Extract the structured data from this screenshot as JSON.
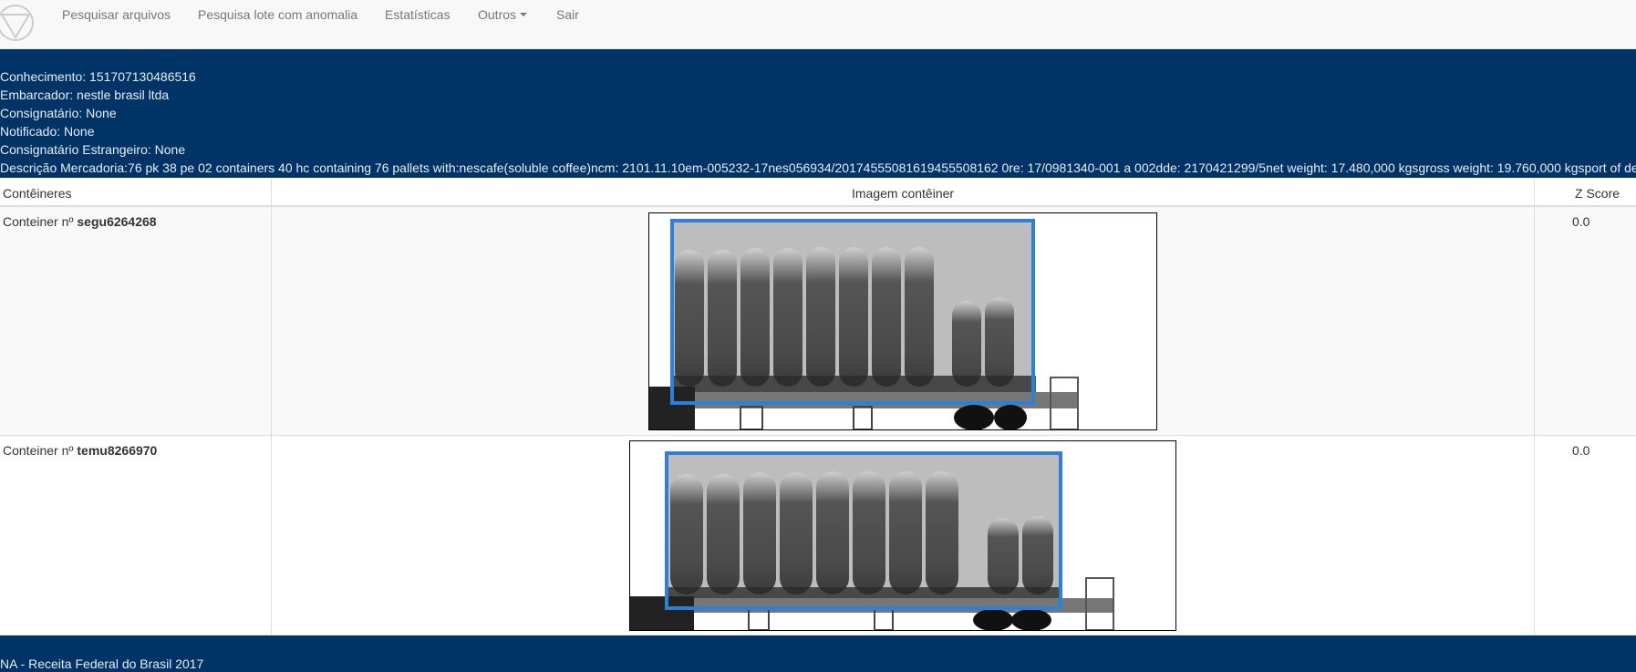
{
  "nav": {
    "logo_icon": "triangle-circle-logo-icon",
    "items": [
      {
        "label": "Pesquisar arquivos"
      },
      {
        "label": "Pesquisa lote com anomalia"
      },
      {
        "label": "Estatísticas"
      },
      {
        "label": "Outros",
        "dropdown": true
      },
      {
        "label": "Sair"
      }
    ]
  },
  "info": {
    "conhecimento": "Conhecimento: 151707130486516",
    "embarcador": "Embarcador: nestle brasil ltda",
    "consignatario": "Consignatário: None",
    "notificado": "Notificado: None",
    "consignatario_estrangeiro": "Consignatário Estrangeiro: None",
    "descricao": "Descrição Mercadoria:76 pk 38 pe 02 containers 40 hc containing 76 pallets with:nescafe(soluble coffee)ncm: 2101.11.10em-005232-17nes056934/20174555081619455508162 0re: 17/0981340-001 a 002dde: 2170421299/5net weight: 17.480,000 kgsgross weight: 19.760,000 kgsport of destination"
  },
  "table": {
    "headers": [
      "Contêineres",
      "Imagem contêiner",
      "Z Score"
    ],
    "rows": [
      {
        "prefix": "Conteiner nº ",
        "id": "segu6264268",
        "zscore": "0.0"
      },
      {
        "prefix": "Conteiner nº ",
        "id": "temu8266970",
        "zscore": "0.0"
      }
    ]
  },
  "colors": {
    "navy": "#003366",
    "detection_box": "#2f7fd6"
  },
  "footer": {
    "text": "NA - Receita Federal do Brasil 2017"
  }
}
